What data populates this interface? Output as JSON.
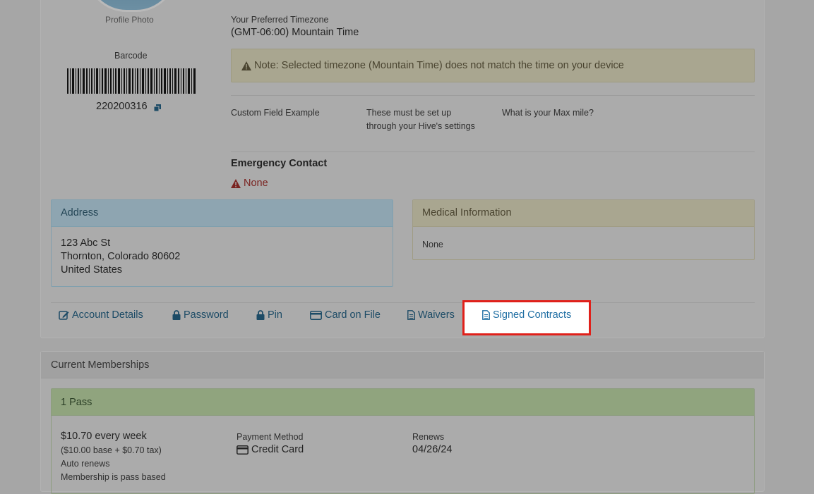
{
  "profile": {
    "photo_label": "Profile Photo",
    "barcode_label": "Barcode",
    "barcode_number": "220200316",
    "copy_icon": "copy-icon"
  },
  "timezone": {
    "label": "Your Preferred Timezone",
    "value": "(GMT-06:00) Mountain Time",
    "note": "Note: Selected timezone (Mountain Time) does not match the time on your device",
    "note_icon": "warning-icon"
  },
  "custom_fields": {
    "field1": "Custom Field Example",
    "field2_line1": "These must be set up",
    "field2_line2": "through your Hive's settings",
    "field3": "What is your Max mile?"
  },
  "emergency": {
    "title": "Emergency Contact",
    "value": "None",
    "icon": "warning-icon"
  },
  "address": {
    "title": "Address",
    "line1": "123 Abc St",
    "line2": "Thornton, Colorado 80602",
    "line3": "United States"
  },
  "medical": {
    "title": "Medical Information",
    "value": "None"
  },
  "tabs": {
    "account_details": "Account Details",
    "password": "Password",
    "pin": "Pin",
    "card_on_file": "Card on File",
    "waivers": "Waivers",
    "signed_contracts": "Signed Contracts"
  },
  "memberships": {
    "title": "Current Memberships",
    "pass_name": "1 Pass",
    "price": "$10.70 every week",
    "price_breakdown": "($10.00 base + $0.70 tax)",
    "auto_renew": "Auto renews",
    "basis": "Membership is pass based",
    "payment_label": "Payment Method",
    "payment_value": "Credit Card",
    "renews_label": "Renews",
    "renews_value": "04/26/24"
  },
  "colors": {
    "overlay": "#a6a6a6",
    "highlight_border": "#e0201a",
    "link": "#1c4b66",
    "danger": "#7a2320"
  }
}
